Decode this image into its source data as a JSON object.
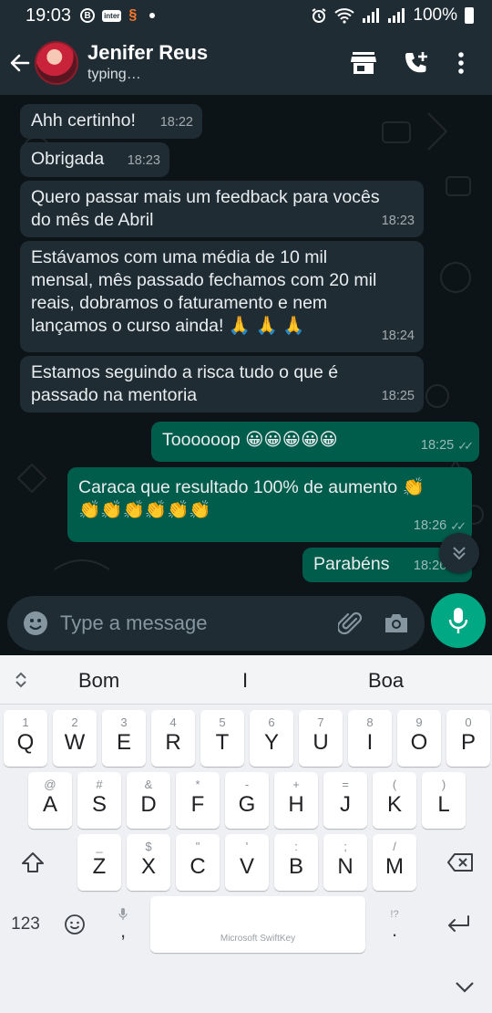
{
  "status_bar": {
    "time": "19:03",
    "left_icons": [
      "b-circle-icon",
      "inter-app-icon",
      "shopee-icon",
      "dot-icon"
    ],
    "inter_label": "inter",
    "b_label": "B",
    "shop_label": "§",
    "battery": "100%"
  },
  "header": {
    "contact_name": "Jenifer Reus",
    "contact_status": "typing…"
  },
  "messages": [
    {
      "dir": "in",
      "text": "Ahh certinho!",
      "time": "18:22"
    },
    {
      "dir": "in",
      "text": "Obrigada",
      "time": "18:23"
    },
    {
      "dir": "in",
      "text": "Quero passar mais um feedback para vocês\ndo mês de Abril",
      "time": "18:23"
    },
    {
      "dir": "in",
      "text": "Estávamos com uma média de 10 mil\nmensal, mês passado fechamos com 20 mil\nreais, dobramos o faturamento e nem\nlançamos o curso ainda! 🙏 🙏 🙏",
      "time": "18:24"
    },
    {
      "dir": "in",
      "text": "Estamos seguindo a risca tudo o que é\npassado na mentoria",
      "time": "18:25"
    },
    {
      "dir": "out",
      "text": "Toooooop 😀😀😀😀😀",
      "time": "18:25"
    },
    {
      "dir": "out",
      "text": "Caraca que resultado 100% de aumento 👏\n👏👏👏👏👏👏",
      "time": "18:26"
    },
    {
      "dir": "out",
      "text": "Parabéns",
      "time": "18:26"
    }
  ],
  "composer": {
    "placeholder": "Type a message"
  },
  "keyboard": {
    "suggestions": [
      "Bom",
      "I",
      "Boa"
    ],
    "row1": [
      {
        "hint": "1",
        "key": "Q"
      },
      {
        "hint": "2",
        "key": "W"
      },
      {
        "hint": "3",
        "key": "E"
      },
      {
        "hint": "4",
        "key": "R"
      },
      {
        "hint": "5",
        "key": "T"
      },
      {
        "hint": "6",
        "key": "Y"
      },
      {
        "hint": "7",
        "key": "U"
      },
      {
        "hint": "8",
        "key": "I"
      },
      {
        "hint": "9",
        "key": "O"
      },
      {
        "hint": "0",
        "key": "P"
      }
    ],
    "row2": [
      {
        "hint": "@",
        "key": "A"
      },
      {
        "hint": "#",
        "key": "S"
      },
      {
        "hint": "&",
        "key": "D"
      },
      {
        "hint": "*",
        "key": "F"
      },
      {
        "hint": "-",
        "key": "G"
      },
      {
        "hint": "+",
        "key": "H"
      },
      {
        "hint": "=",
        "key": "J"
      },
      {
        "hint": "(",
        "key": "K"
      },
      {
        "hint": ")",
        "key": "L"
      }
    ],
    "row3": [
      {
        "hint": "_",
        "key": "Z"
      },
      {
        "hint": "$",
        "key": "X"
      },
      {
        "hint": "\"",
        "key": "C"
      },
      {
        "hint": "'",
        "key": "V"
      },
      {
        "hint": ":",
        "key": "B"
      },
      {
        "hint": ";",
        "key": "N"
      },
      {
        "hint": "/",
        "key": "M"
      }
    ],
    "numbers_label": "123",
    "comma_label": ",",
    "period_label": ".",
    "period_hint": "!?",
    "space_label": "Microsoft SwiftKey"
  },
  "colors": {
    "header": "#1f2c34",
    "incoming_bubble": "#1f2c34",
    "outgoing_bubble": "#005c4b",
    "accent": "#00a884"
  }
}
